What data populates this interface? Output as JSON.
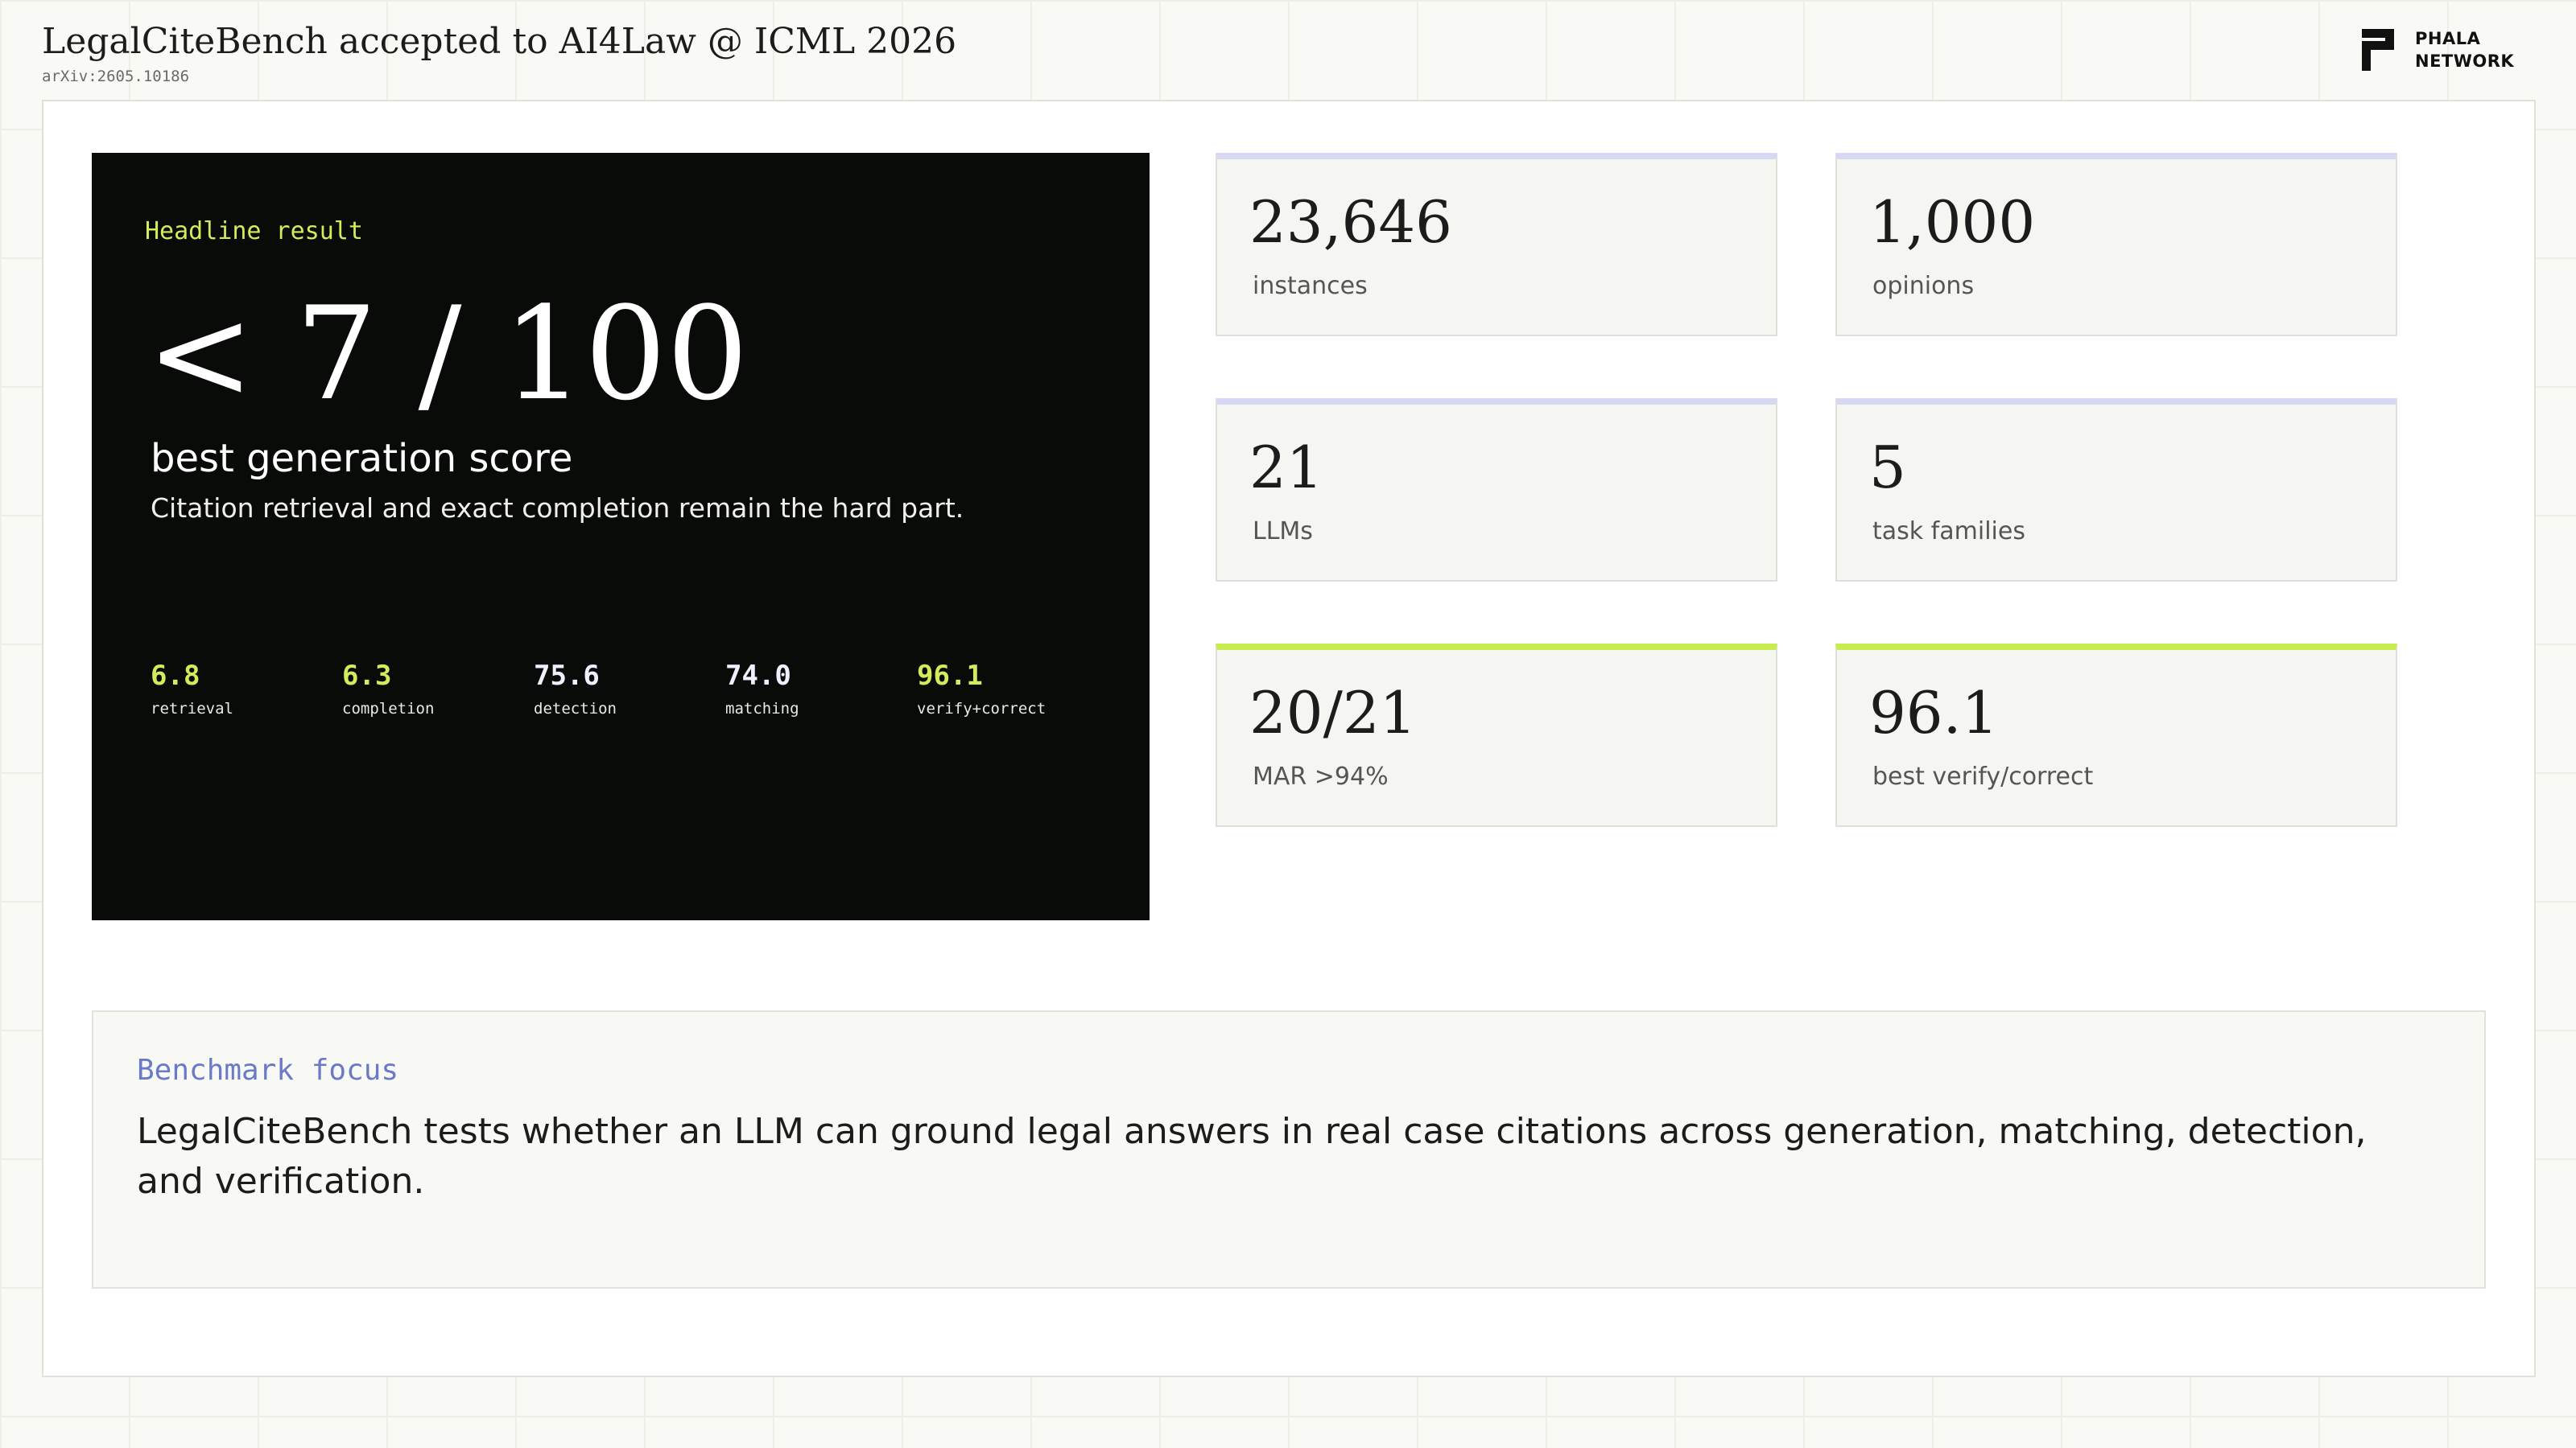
{
  "header": {
    "title": "LegalCiteBench accepted to AI4Law @ ICML 2026",
    "arxiv": "arXiv:2605.10186",
    "logo": {
      "line1": "PHALA",
      "line2": "NETWORK",
      "icon": "phala-logo-icon"
    }
  },
  "hero": {
    "eyebrow": "Headline result",
    "big": "< 7 / 100",
    "sub": "best generation score",
    "desc": "Citation retrieval and exact completion remain the hard part.",
    "metrics": [
      {
        "value": "6.8",
        "label": "retrieval",
        "highlight": true
      },
      {
        "value": "6.3",
        "label": "completion",
        "highlight": true
      },
      {
        "value": "75.6",
        "label": "detection",
        "highlight": false
      },
      {
        "value": "74.0",
        "label": "matching",
        "highlight": false
      },
      {
        "value": "96.1",
        "label": "verify+correct",
        "highlight": true
      }
    ]
  },
  "stats": [
    {
      "value": "23,646",
      "label": "instances",
      "accent": false
    },
    {
      "value": "1,000",
      "label": "opinions",
      "accent": false
    },
    {
      "value": "21",
      "label": "LLMs",
      "accent": false
    },
    {
      "value": "5",
      "label": "task families",
      "accent": false
    },
    {
      "value": "20/21",
      "label": "MAR >94%",
      "accent": true
    },
    {
      "value": "96.1",
      "label": "best verify/correct",
      "accent": true
    }
  ],
  "focus": {
    "label": "Benchmark focus",
    "text": "LegalCiteBench tests whether an LLM can ground legal answers in real case citations across generation, matching, detection, and verification."
  },
  "colors": {
    "accent_lime": "#c8ec4d",
    "accent_lavender": "#d7d9f4",
    "hero_bg": "#090b09",
    "focus_label": "#6a79c8"
  }
}
